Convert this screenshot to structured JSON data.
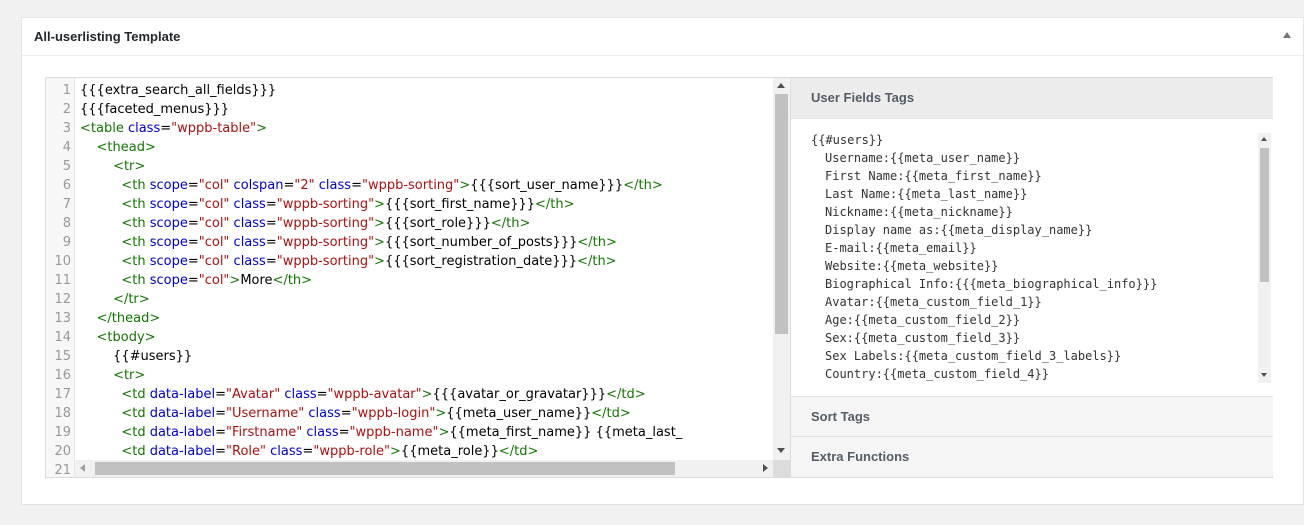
{
  "panel": {
    "title": "All-userlisting Template"
  },
  "editor": {
    "lines": [
      {
        "n": "1",
        "tokens": [
          {
            "t": "text",
            "v": "{{{extra_search_all_fields}}}"
          }
        ]
      },
      {
        "n": "2",
        "tokens": [
          {
            "t": "text",
            "v": "{{{faceted_menus}}}"
          }
        ]
      },
      {
        "n": "3",
        "tokens": [
          {
            "t": "tag",
            "v": "<table "
          },
          {
            "t": "attr",
            "v": "class"
          },
          {
            "t": "text",
            "v": "="
          },
          {
            "t": "str",
            "v": "\"wppb-table\""
          },
          {
            "t": "tag",
            "v": ">"
          }
        ]
      },
      {
        "n": "4",
        "tokens": [
          {
            "t": "text",
            "v": "    "
          },
          {
            "t": "tag",
            "v": "<thead>"
          }
        ]
      },
      {
        "n": "5",
        "tokens": [
          {
            "t": "text",
            "v": "        "
          },
          {
            "t": "tag",
            "v": "<tr>"
          }
        ]
      },
      {
        "n": "6",
        "tokens": [
          {
            "t": "text",
            "v": "          "
          },
          {
            "t": "tag",
            "v": "<th "
          },
          {
            "t": "attr",
            "v": "scope"
          },
          {
            "t": "text",
            "v": "="
          },
          {
            "t": "str",
            "v": "\"col\""
          },
          {
            "t": "text",
            "v": " "
          },
          {
            "t": "attr",
            "v": "colspan"
          },
          {
            "t": "text",
            "v": "="
          },
          {
            "t": "str",
            "v": "\"2\""
          },
          {
            "t": "text",
            "v": " "
          },
          {
            "t": "attr",
            "v": "class"
          },
          {
            "t": "text",
            "v": "="
          },
          {
            "t": "str",
            "v": "\"wppb-sorting\""
          },
          {
            "t": "tag",
            "v": ">"
          },
          {
            "t": "text",
            "v": "{{{sort_user_name}}}"
          },
          {
            "t": "tag",
            "v": "</th>"
          }
        ]
      },
      {
        "n": "7",
        "tokens": [
          {
            "t": "text",
            "v": "          "
          },
          {
            "t": "tag",
            "v": "<th "
          },
          {
            "t": "attr",
            "v": "scope"
          },
          {
            "t": "text",
            "v": "="
          },
          {
            "t": "str",
            "v": "\"col\""
          },
          {
            "t": "text",
            "v": " "
          },
          {
            "t": "attr",
            "v": "class"
          },
          {
            "t": "text",
            "v": "="
          },
          {
            "t": "str",
            "v": "\"wppb-sorting\""
          },
          {
            "t": "tag",
            "v": ">"
          },
          {
            "t": "text",
            "v": "{{{sort_first_name}}}"
          },
          {
            "t": "tag",
            "v": "</th>"
          }
        ]
      },
      {
        "n": "8",
        "tokens": [
          {
            "t": "text",
            "v": "          "
          },
          {
            "t": "tag",
            "v": "<th "
          },
          {
            "t": "attr",
            "v": "scope"
          },
          {
            "t": "text",
            "v": "="
          },
          {
            "t": "str",
            "v": "\"col\""
          },
          {
            "t": "text",
            "v": " "
          },
          {
            "t": "attr",
            "v": "class"
          },
          {
            "t": "text",
            "v": "="
          },
          {
            "t": "str",
            "v": "\"wppb-sorting\""
          },
          {
            "t": "tag",
            "v": ">"
          },
          {
            "t": "text",
            "v": "{{{sort_role}}}"
          },
          {
            "t": "tag",
            "v": "</th>"
          }
        ]
      },
      {
        "n": "9",
        "tokens": [
          {
            "t": "text",
            "v": "          "
          },
          {
            "t": "tag",
            "v": "<th "
          },
          {
            "t": "attr",
            "v": "scope"
          },
          {
            "t": "text",
            "v": "="
          },
          {
            "t": "str",
            "v": "\"col\""
          },
          {
            "t": "text",
            "v": " "
          },
          {
            "t": "attr",
            "v": "class"
          },
          {
            "t": "text",
            "v": "="
          },
          {
            "t": "str",
            "v": "\"wppb-sorting\""
          },
          {
            "t": "tag",
            "v": ">"
          },
          {
            "t": "text",
            "v": "{{{sort_number_of_posts}}}"
          },
          {
            "t": "tag",
            "v": "</th>"
          }
        ]
      },
      {
        "n": "10",
        "tokens": [
          {
            "t": "text",
            "v": "          "
          },
          {
            "t": "tag",
            "v": "<th "
          },
          {
            "t": "attr",
            "v": "scope"
          },
          {
            "t": "text",
            "v": "="
          },
          {
            "t": "str",
            "v": "\"col\""
          },
          {
            "t": "text",
            "v": " "
          },
          {
            "t": "attr",
            "v": "class"
          },
          {
            "t": "text",
            "v": "="
          },
          {
            "t": "str",
            "v": "\"wppb-sorting\""
          },
          {
            "t": "tag",
            "v": ">"
          },
          {
            "t": "text",
            "v": "{{{sort_registration_date}}}"
          },
          {
            "t": "tag",
            "v": "</th>"
          }
        ]
      },
      {
        "n": "11",
        "tokens": [
          {
            "t": "text",
            "v": "          "
          },
          {
            "t": "tag",
            "v": "<th "
          },
          {
            "t": "attr",
            "v": "scope"
          },
          {
            "t": "text",
            "v": "="
          },
          {
            "t": "str",
            "v": "\"col\""
          },
          {
            "t": "tag",
            "v": ">"
          },
          {
            "t": "text",
            "v": "More"
          },
          {
            "t": "tag",
            "v": "</th>"
          }
        ]
      },
      {
        "n": "12",
        "tokens": [
          {
            "t": "text",
            "v": "        "
          },
          {
            "t": "tag",
            "v": "</tr>"
          }
        ]
      },
      {
        "n": "13",
        "tokens": [
          {
            "t": "text",
            "v": "    "
          },
          {
            "t": "tag",
            "v": "</thead>"
          }
        ]
      },
      {
        "n": "14",
        "tokens": [
          {
            "t": "text",
            "v": "    "
          },
          {
            "t": "tag",
            "v": "<tbody>"
          }
        ]
      },
      {
        "n": "15",
        "tokens": [
          {
            "t": "text",
            "v": "        {{#users}}"
          }
        ]
      },
      {
        "n": "16",
        "tokens": [
          {
            "t": "text",
            "v": "        "
          },
          {
            "t": "tag",
            "v": "<tr>"
          }
        ]
      },
      {
        "n": "17",
        "tokens": [
          {
            "t": "text",
            "v": "          "
          },
          {
            "t": "tag",
            "v": "<td "
          },
          {
            "t": "attr",
            "v": "data-label"
          },
          {
            "t": "text",
            "v": "="
          },
          {
            "t": "str",
            "v": "\"Avatar\""
          },
          {
            "t": "text",
            "v": " "
          },
          {
            "t": "attr",
            "v": "class"
          },
          {
            "t": "text",
            "v": "="
          },
          {
            "t": "str",
            "v": "\"wppb-avatar\""
          },
          {
            "t": "tag",
            "v": ">"
          },
          {
            "t": "text",
            "v": "{{{avatar_or_gravatar}}}"
          },
          {
            "t": "tag",
            "v": "</td>"
          }
        ]
      },
      {
        "n": "18",
        "tokens": [
          {
            "t": "text",
            "v": "          "
          },
          {
            "t": "tag",
            "v": "<td "
          },
          {
            "t": "attr",
            "v": "data-label"
          },
          {
            "t": "text",
            "v": "="
          },
          {
            "t": "str",
            "v": "\"Username\""
          },
          {
            "t": "text",
            "v": " "
          },
          {
            "t": "attr",
            "v": "class"
          },
          {
            "t": "text",
            "v": "="
          },
          {
            "t": "str",
            "v": "\"wppb-login\""
          },
          {
            "t": "tag",
            "v": ">"
          },
          {
            "t": "text",
            "v": "{{meta_user_name}}"
          },
          {
            "t": "tag",
            "v": "</td>"
          }
        ]
      },
      {
        "n": "19",
        "tokens": [
          {
            "t": "text",
            "v": "          "
          },
          {
            "t": "tag",
            "v": "<td "
          },
          {
            "t": "attr",
            "v": "data-label"
          },
          {
            "t": "text",
            "v": "="
          },
          {
            "t": "str",
            "v": "\"Firstname\""
          },
          {
            "t": "text",
            "v": " "
          },
          {
            "t": "attr",
            "v": "class"
          },
          {
            "t": "text",
            "v": "="
          },
          {
            "t": "str",
            "v": "\"wppb-name\""
          },
          {
            "t": "tag",
            "v": ">"
          },
          {
            "t": "text",
            "v": "{{meta_first_name}} {{meta_last_"
          }
        ]
      },
      {
        "n": "20",
        "tokens": [
          {
            "t": "text",
            "v": "          "
          },
          {
            "t": "tag",
            "v": "<td "
          },
          {
            "t": "attr",
            "v": "data-label"
          },
          {
            "t": "text",
            "v": "="
          },
          {
            "t": "str",
            "v": "\"Role\""
          },
          {
            "t": "text",
            "v": " "
          },
          {
            "t": "attr",
            "v": "class"
          },
          {
            "t": "text",
            "v": "="
          },
          {
            "t": "str",
            "v": "\"wppb-role\""
          },
          {
            "t": "tag",
            "v": ">"
          },
          {
            "t": "text",
            "v": "{{meta_role}}"
          },
          {
            "t": "tag",
            "v": "</td>"
          }
        ]
      },
      {
        "n": "21",
        "tokens": []
      }
    ]
  },
  "side_panel": {
    "user_fields_title": "User Fields Tags",
    "sort_tags_title": "Sort Tags",
    "extra_functions_title": "Extra Functions",
    "user_tags": [
      {
        "text": "{{#users}}",
        "indent": false
      },
      {
        "text": "Username:{{meta_user_name}}",
        "indent": true
      },
      {
        "text": "First Name:{{meta_first_name}}",
        "indent": true
      },
      {
        "text": "Last Name:{{meta_last_name}}",
        "indent": true
      },
      {
        "text": "Nickname:{{meta_nickname}}",
        "indent": true
      },
      {
        "text": "Display name as:{{meta_display_name}}",
        "indent": true
      },
      {
        "text": "E-mail:{{meta_email}}",
        "indent": true
      },
      {
        "text": "Website:{{meta_website}}",
        "indent": true
      },
      {
        "text": "Biographical Info:{{{meta_biographical_info}}}",
        "indent": true
      },
      {
        "text": "Avatar:{{meta_custom_field_1}}",
        "indent": true
      },
      {
        "text": "Age:{{meta_custom_field_2}}",
        "indent": true
      },
      {
        "text": "Sex:{{meta_custom_field_3}}",
        "indent": true
      },
      {
        "text": "Sex Labels:{{meta_custom_field_3_labels}}",
        "indent": true
      },
      {
        "text": "Country:{{meta_custom_field_4}}",
        "indent": true
      }
    ]
  },
  "colors": {
    "tag": "#117700",
    "attr": "#0000cc",
    "string": "#aa1111"
  }
}
